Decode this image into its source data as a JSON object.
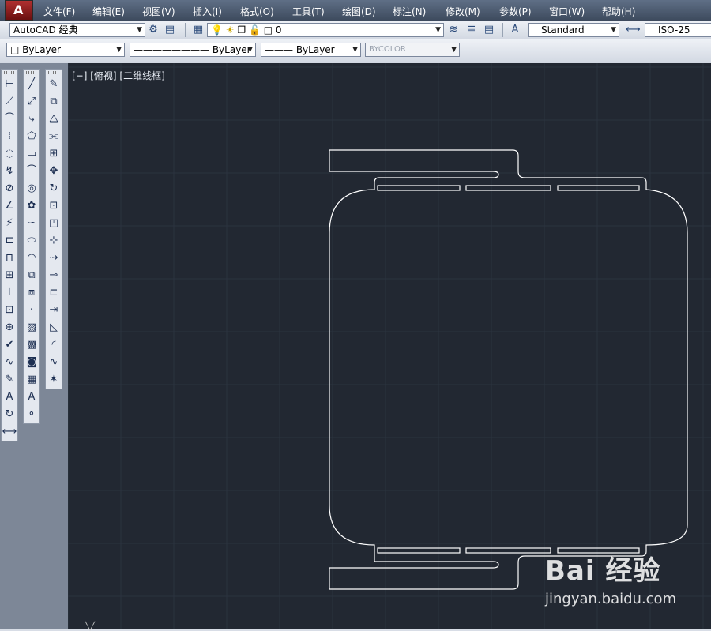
{
  "menu": [
    "文件(F)",
    "编辑(E)",
    "视图(V)",
    "插入(I)",
    "格式(O)",
    "工具(T)",
    "绘图(D)",
    "标注(N)",
    "修改(M)",
    "参数(P)",
    "窗口(W)",
    "帮助(H)"
  ],
  "toolbar": {
    "workspace": "AutoCAD 经典",
    "layer": "0",
    "text_style": "Standard",
    "dim_style": "ISO-25",
    "color": "ByLayer",
    "linetype": "ByLayer",
    "lineweight": "ByLayer",
    "plot_style": "BYCOLOR"
  },
  "viewport": {
    "label": "[−] [俯视] [二维线框]"
  },
  "watermark": {
    "brand": "Bai 经验",
    "url": "jingyan.baidu.com"
  }
}
